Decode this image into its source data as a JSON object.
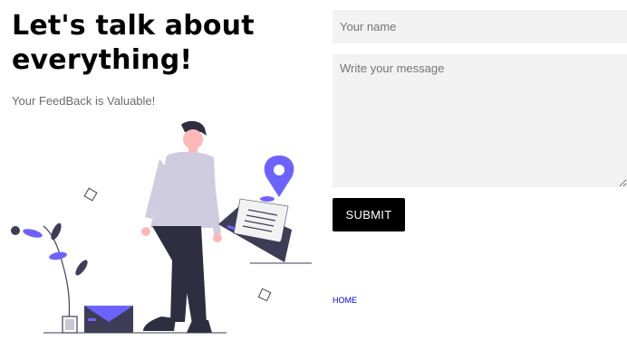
{
  "hero": {
    "title_line1": "Let's talk about",
    "title_line2": "everything!",
    "subtitle": "Your FeedBack is Valuable!"
  },
  "form": {
    "name_placeholder": "Your name",
    "message_placeholder": "Write your message",
    "submit_label": "SUBMIT"
  },
  "footer": {
    "home_link": "HOME"
  },
  "colors": {
    "accent": "#6c63ff",
    "dark": "#3f3d56",
    "field_bg": "#f2f2f2",
    "button_bg": "#000000",
    "link": "#0000ee"
  },
  "illustration": {
    "icons": [
      "person-figure",
      "envelope-icon",
      "map-pin-icon",
      "plant-icon",
      "paper-letter-icon"
    ]
  }
}
